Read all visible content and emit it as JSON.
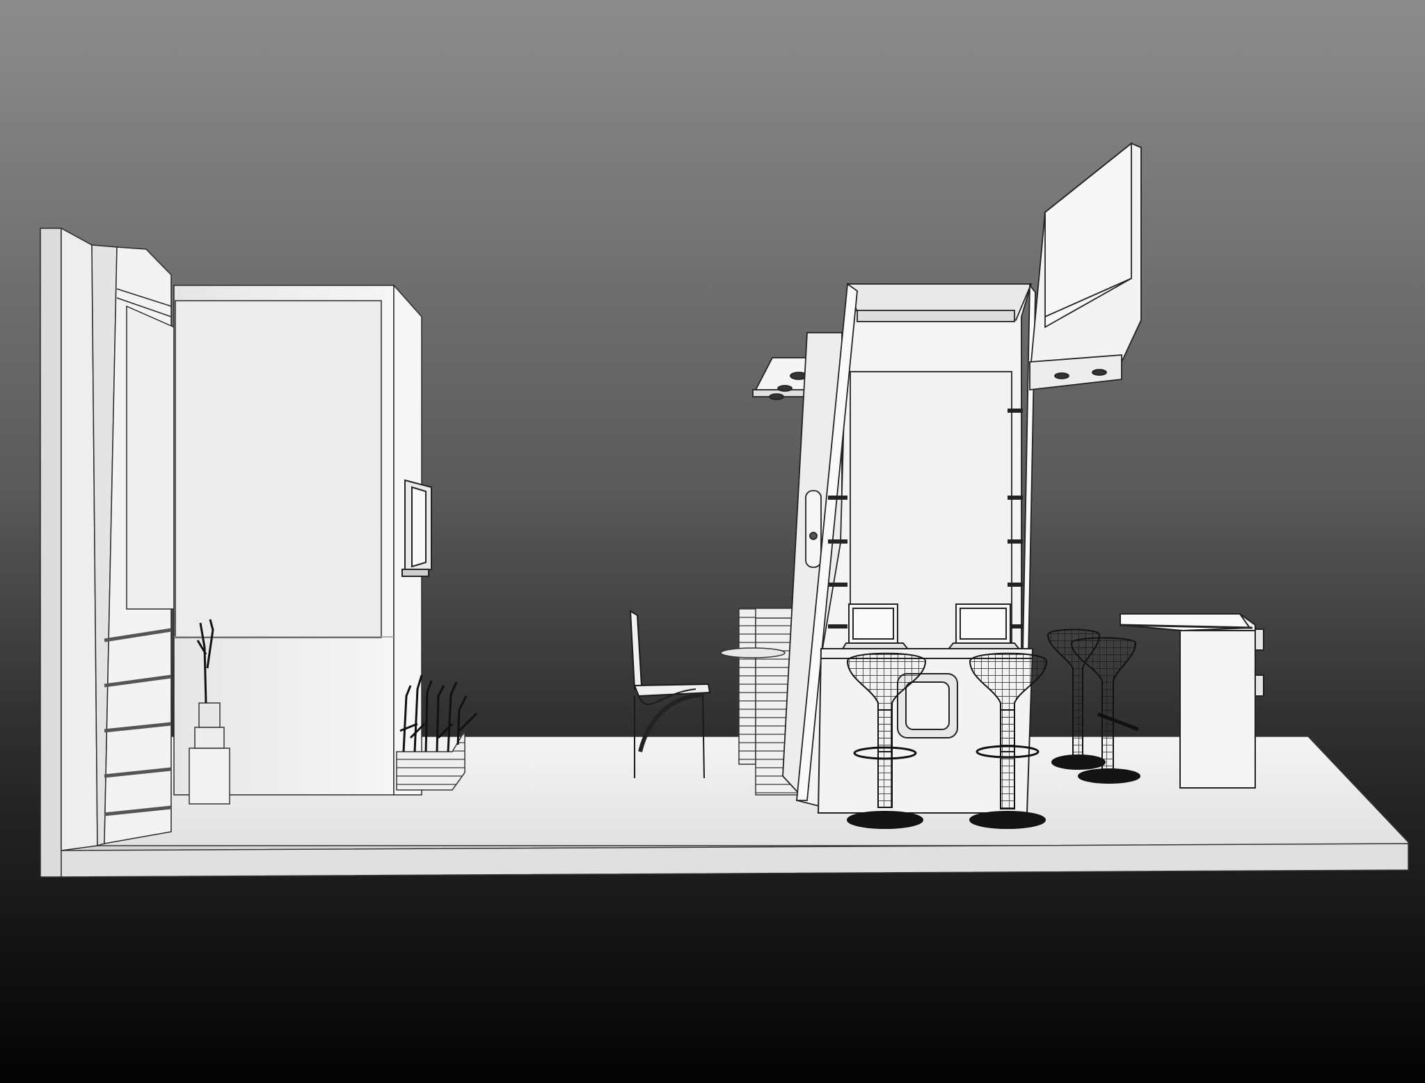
{
  "image": {
    "kind": "3d-clay-render",
    "subject": "exhibition-booth",
    "colors": {
      "background_top": "#8a8a8a",
      "background_mid": "#4a4a4a",
      "background_bottom": "#050505",
      "surface": "#f2f2f2",
      "surface_shade": "#d6d6d6",
      "edge": "#222222",
      "metal": "#161616"
    }
  }
}
